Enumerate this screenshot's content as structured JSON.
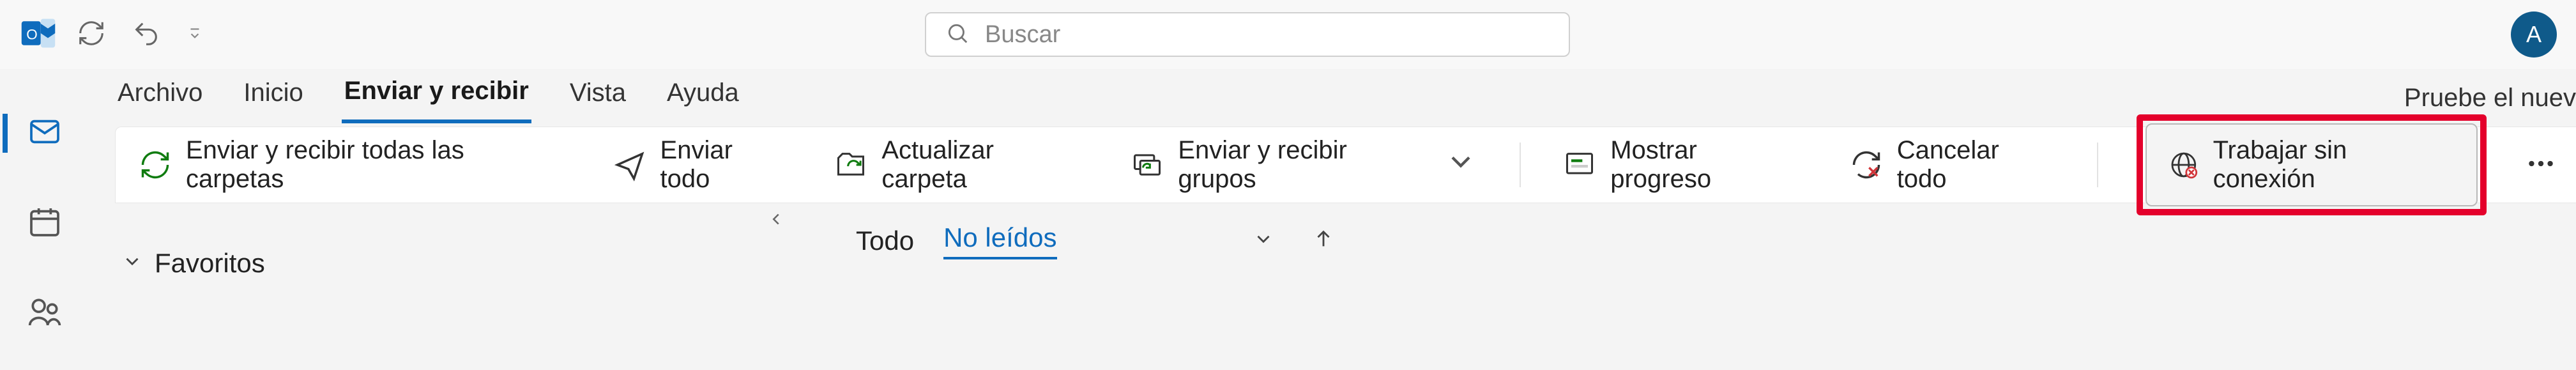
{
  "titlebar": {
    "avatar_letter": "A"
  },
  "search": {
    "placeholder": "Buscar"
  },
  "tabs": {
    "archivo": "Archivo",
    "inicio": "Inicio",
    "enviar_recibir": "Enviar y recibir",
    "vista": "Vista",
    "ayuda": "Ayuda"
  },
  "promo": "Pruebe el nuev",
  "ribbon": {
    "send_receive_all": "Enviar y recibir todas las carpetas",
    "send_all": "Enviar todo",
    "update_folder": "Actualizar carpeta",
    "groups": "Enviar y recibir grupos",
    "show_progress": "Mostrar progreso",
    "cancel_all": "Cancelar todo",
    "work_offline": "Trabajar sin conexión"
  },
  "nav": {
    "favoritos": "Favoritos"
  },
  "filters": {
    "todo": "Todo",
    "unread": "No leídos"
  }
}
